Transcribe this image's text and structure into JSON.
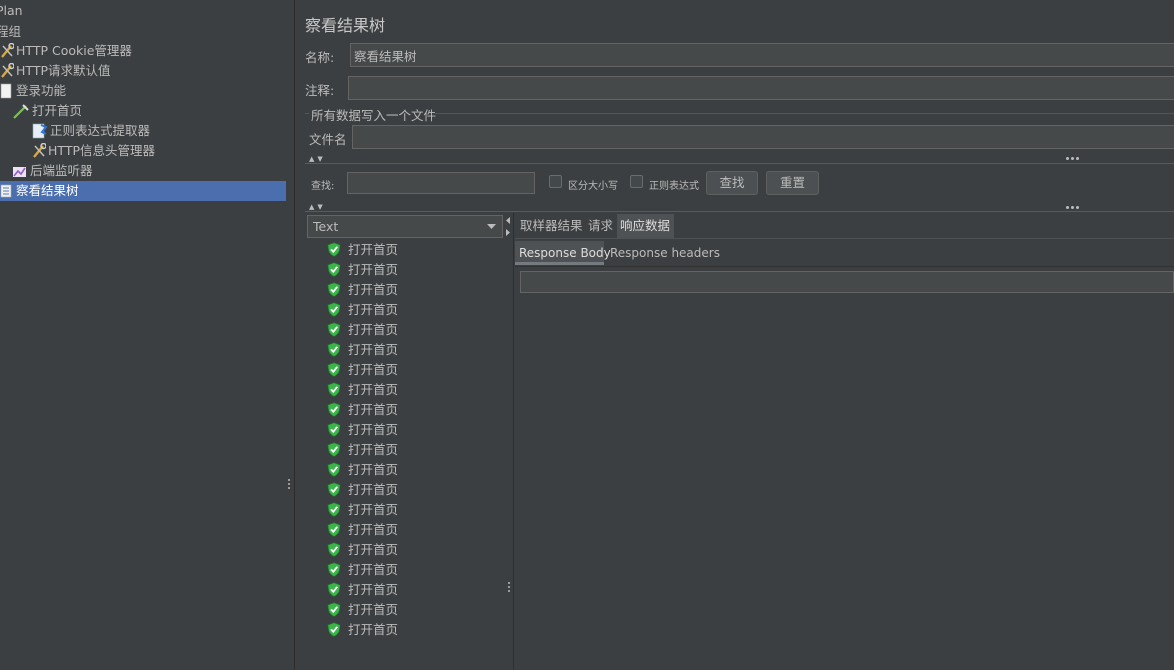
{
  "tree": {
    "items": [
      {
        "label": "Plan",
        "indent": 0
      },
      {
        "label": "程组",
        "indent": 0
      },
      {
        "label": "HTTP Cookie管理器",
        "indent": 1
      },
      {
        "label": "HTTP请求默认值",
        "indent": 1
      },
      {
        "label": "登录功能",
        "indent": 1
      },
      {
        "label": "打开首页",
        "indent": 2
      },
      {
        "label": "正则表达式提取器",
        "indent": 3
      },
      {
        "label": "HTTP信息头管理器",
        "indent": 3
      },
      {
        "label": "后端监听器",
        "indent": 2
      },
      {
        "label": "察看结果树",
        "indent": 1
      }
    ]
  },
  "panel": {
    "title": "察看结果树",
    "name_label": "名称:",
    "name_value": "察看结果树",
    "comment_label": "注释:",
    "comment_value": "",
    "file_section_label": "所有数据写入一个文件",
    "file_label": "文件名",
    "file_value": ""
  },
  "search": {
    "label": "查找:",
    "value": "",
    "case_label": "区分大小写",
    "regex_label": "正则表达式",
    "find_button": "查找",
    "reset_button": "重置"
  },
  "renderer": {
    "selected": "Text"
  },
  "results": {
    "items": [
      "打开首页",
      "打开首页",
      "打开首页",
      "打开首页",
      "打开首页",
      "打开首页",
      "打开首页",
      "打开首页",
      "打开首页",
      "打开首页",
      "打开首页",
      "打开首页",
      "打开首页",
      "打开首页",
      "打开首页",
      "打开首页",
      "打开首页",
      "打开首页",
      "打开首页",
      "打开首页"
    ]
  },
  "tabs": {
    "items": [
      "取样器结果",
      "请求",
      "响应数据"
    ],
    "active": "响应数据"
  },
  "subtabs": {
    "items": [
      "Response Body",
      "Response headers"
    ],
    "active": "Response Body"
  },
  "colors": {
    "background": "#3c3f41",
    "selection": "#4b6eaf",
    "success_check": "#3bb54a"
  }
}
